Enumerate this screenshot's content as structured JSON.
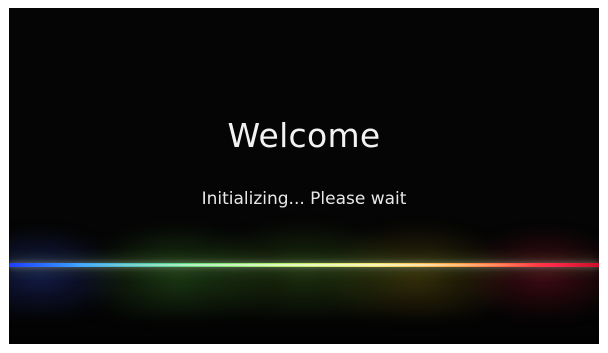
{
  "screen": {
    "title": "Welcome",
    "status": "Initializing... Please wait"
  }
}
